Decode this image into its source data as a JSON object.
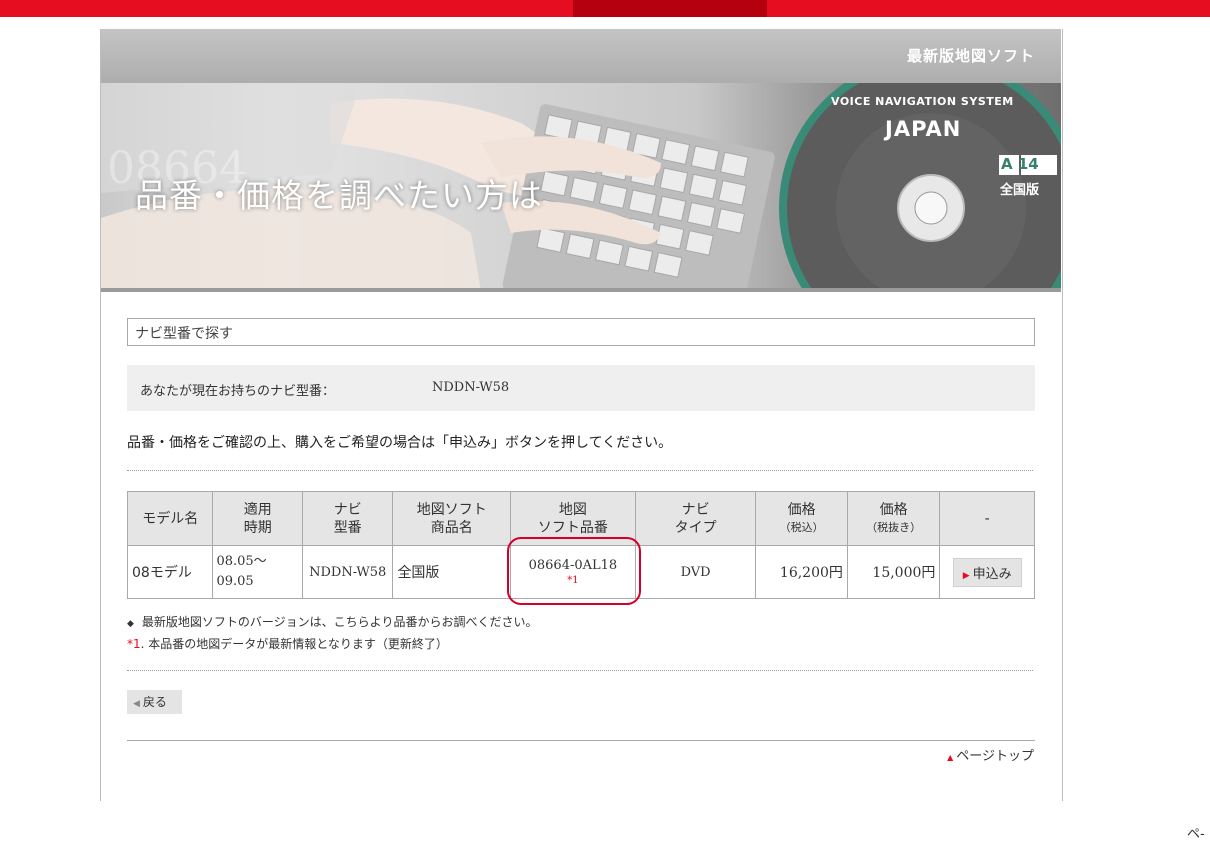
{
  "header": {
    "title": "最新版地図ソフト"
  },
  "banner": {
    "heading": "品番・価格を調べたい方は",
    "background_numbers": "08664",
    "disc": {
      "system": "VOICE NAVIGATION SYSTEM",
      "country": "JAPAN",
      "area_code": "A 14",
      "edition": "全国版"
    }
  },
  "search": {
    "section_title": "ナビ型番で探す",
    "current_label": "あなたが現在お持ちのナビ型番：",
    "current_value": "NDDN-W58",
    "instruction": "品番・価格をご確認の上、購入をご希望の場合は「申込み」ボタンを押してください。"
  },
  "table": {
    "headers": {
      "model": "モデル名",
      "period_1": "適用",
      "period_2": "時期",
      "navi_model_1": "ナビ",
      "navi_model_2": "型番",
      "product_1": "地図ソフト",
      "product_2": "商品名",
      "part_1": "地図",
      "part_2": "ソフト品番",
      "navi_type_1": "ナビ",
      "navi_type_2": "タイプ",
      "price_tax_in": "価格",
      "price_tax_in_note": "（税込）",
      "price_tax_ex": "価格",
      "price_tax_ex_note": "（税抜き）",
      "action": "-"
    },
    "rows": [
      {
        "model": "08モデル",
        "period_1": "08.05～",
        "period_2": "09.05",
        "navi_model": "NDDN-W58",
        "product": "全国版",
        "part_number": "08664-0AL18",
        "part_note": "*1",
        "navi_type": "DVD",
        "price_tax_in": "16,200円",
        "price_tax_ex": "15,000円",
        "apply_label": "申込み"
      }
    ]
  },
  "notes": {
    "note1_mark": "◆",
    "note1": "最新版地図ソフトのバージョンは、こちらより品番からお調べください。",
    "note2_mark": "*1",
    "note2": ". 本品番の地図データが最新情報となります（更新終了）"
  },
  "nav": {
    "back_label": "戻る",
    "page_top_label": "ページトップ"
  },
  "edge_fragment": "ペ-",
  "colors": {
    "brand_red": "#e60d20",
    "highlight_red": "#d4002a",
    "header_gray": "#b8b8b8"
  }
}
